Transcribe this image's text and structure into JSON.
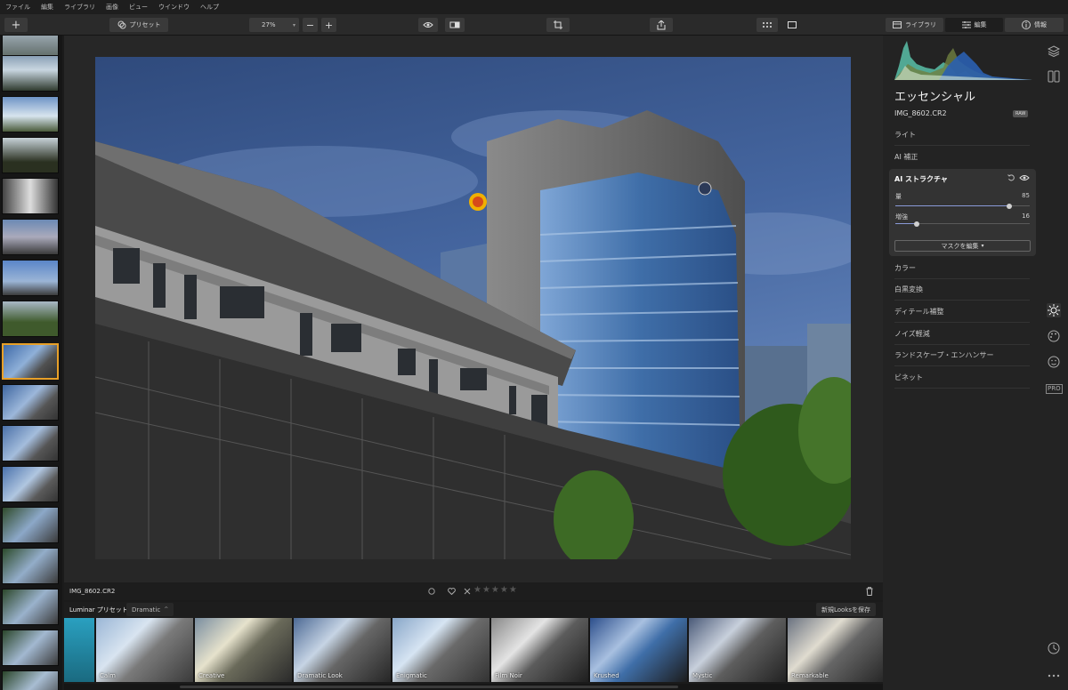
{
  "menu": [
    "ファイル",
    "編集",
    "ライブラリ",
    "画像",
    "ビュー",
    "ウインドウ",
    "ヘルプ"
  ],
  "toolbar": {
    "add_label": "+",
    "preset_label": "プリセット",
    "zoom_value": "27%",
    "zoom_minus": "−",
    "zoom_plus": "+",
    "library_tab": "ライブラリ",
    "edit_tab": "編集",
    "info_tab": "情報"
  },
  "image": {
    "filename": "IMG_8602.CR2",
    "rating_stars": "★★★★★"
  },
  "presets": {
    "section_label": "Luminar プリセット",
    "category": "Dramatic",
    "save_button": "新規Looksを保存",
    "items": [
      "Calm",
      "Creative",
      "Dramatic Look",
      "Enigmatic",
      "Film Noir",
      "Krushed",
      "Mystic",
      "Remarkable"
    ]
  },
  "panel": {
    "title": "エッセンシャル",
    "filename": "IMG_8602.CR2",
    "raw_badge": "RAW",
    "sections_top": [
      "ライト",
      "AI 補正"
    ],
    "ai_structure": {
      "title": "AI ストラクチャ",
      "amount_label": "量",
      "amount_value": "85",
      "amount_fraction": 0.85,
      "boost_label": "増強",
      "boost_value": "16",
      "boost_fraction": 0.16,
      "mask_button": "マスクを編集"
    },
    "sections_bottom": [
      "カラー",
      "白黒変換",
      "ディテール補整",
      "ノイズ軽減",
      "ランドスケープ・エンハンサー",
      "ビネット"
    ]
  },
  "right_icons": {
    "pro_badge": "PRO"
  },
  "colors": {
    "selection": "#e8a028",
    "accent": "#8a9ad8"
  }
}
